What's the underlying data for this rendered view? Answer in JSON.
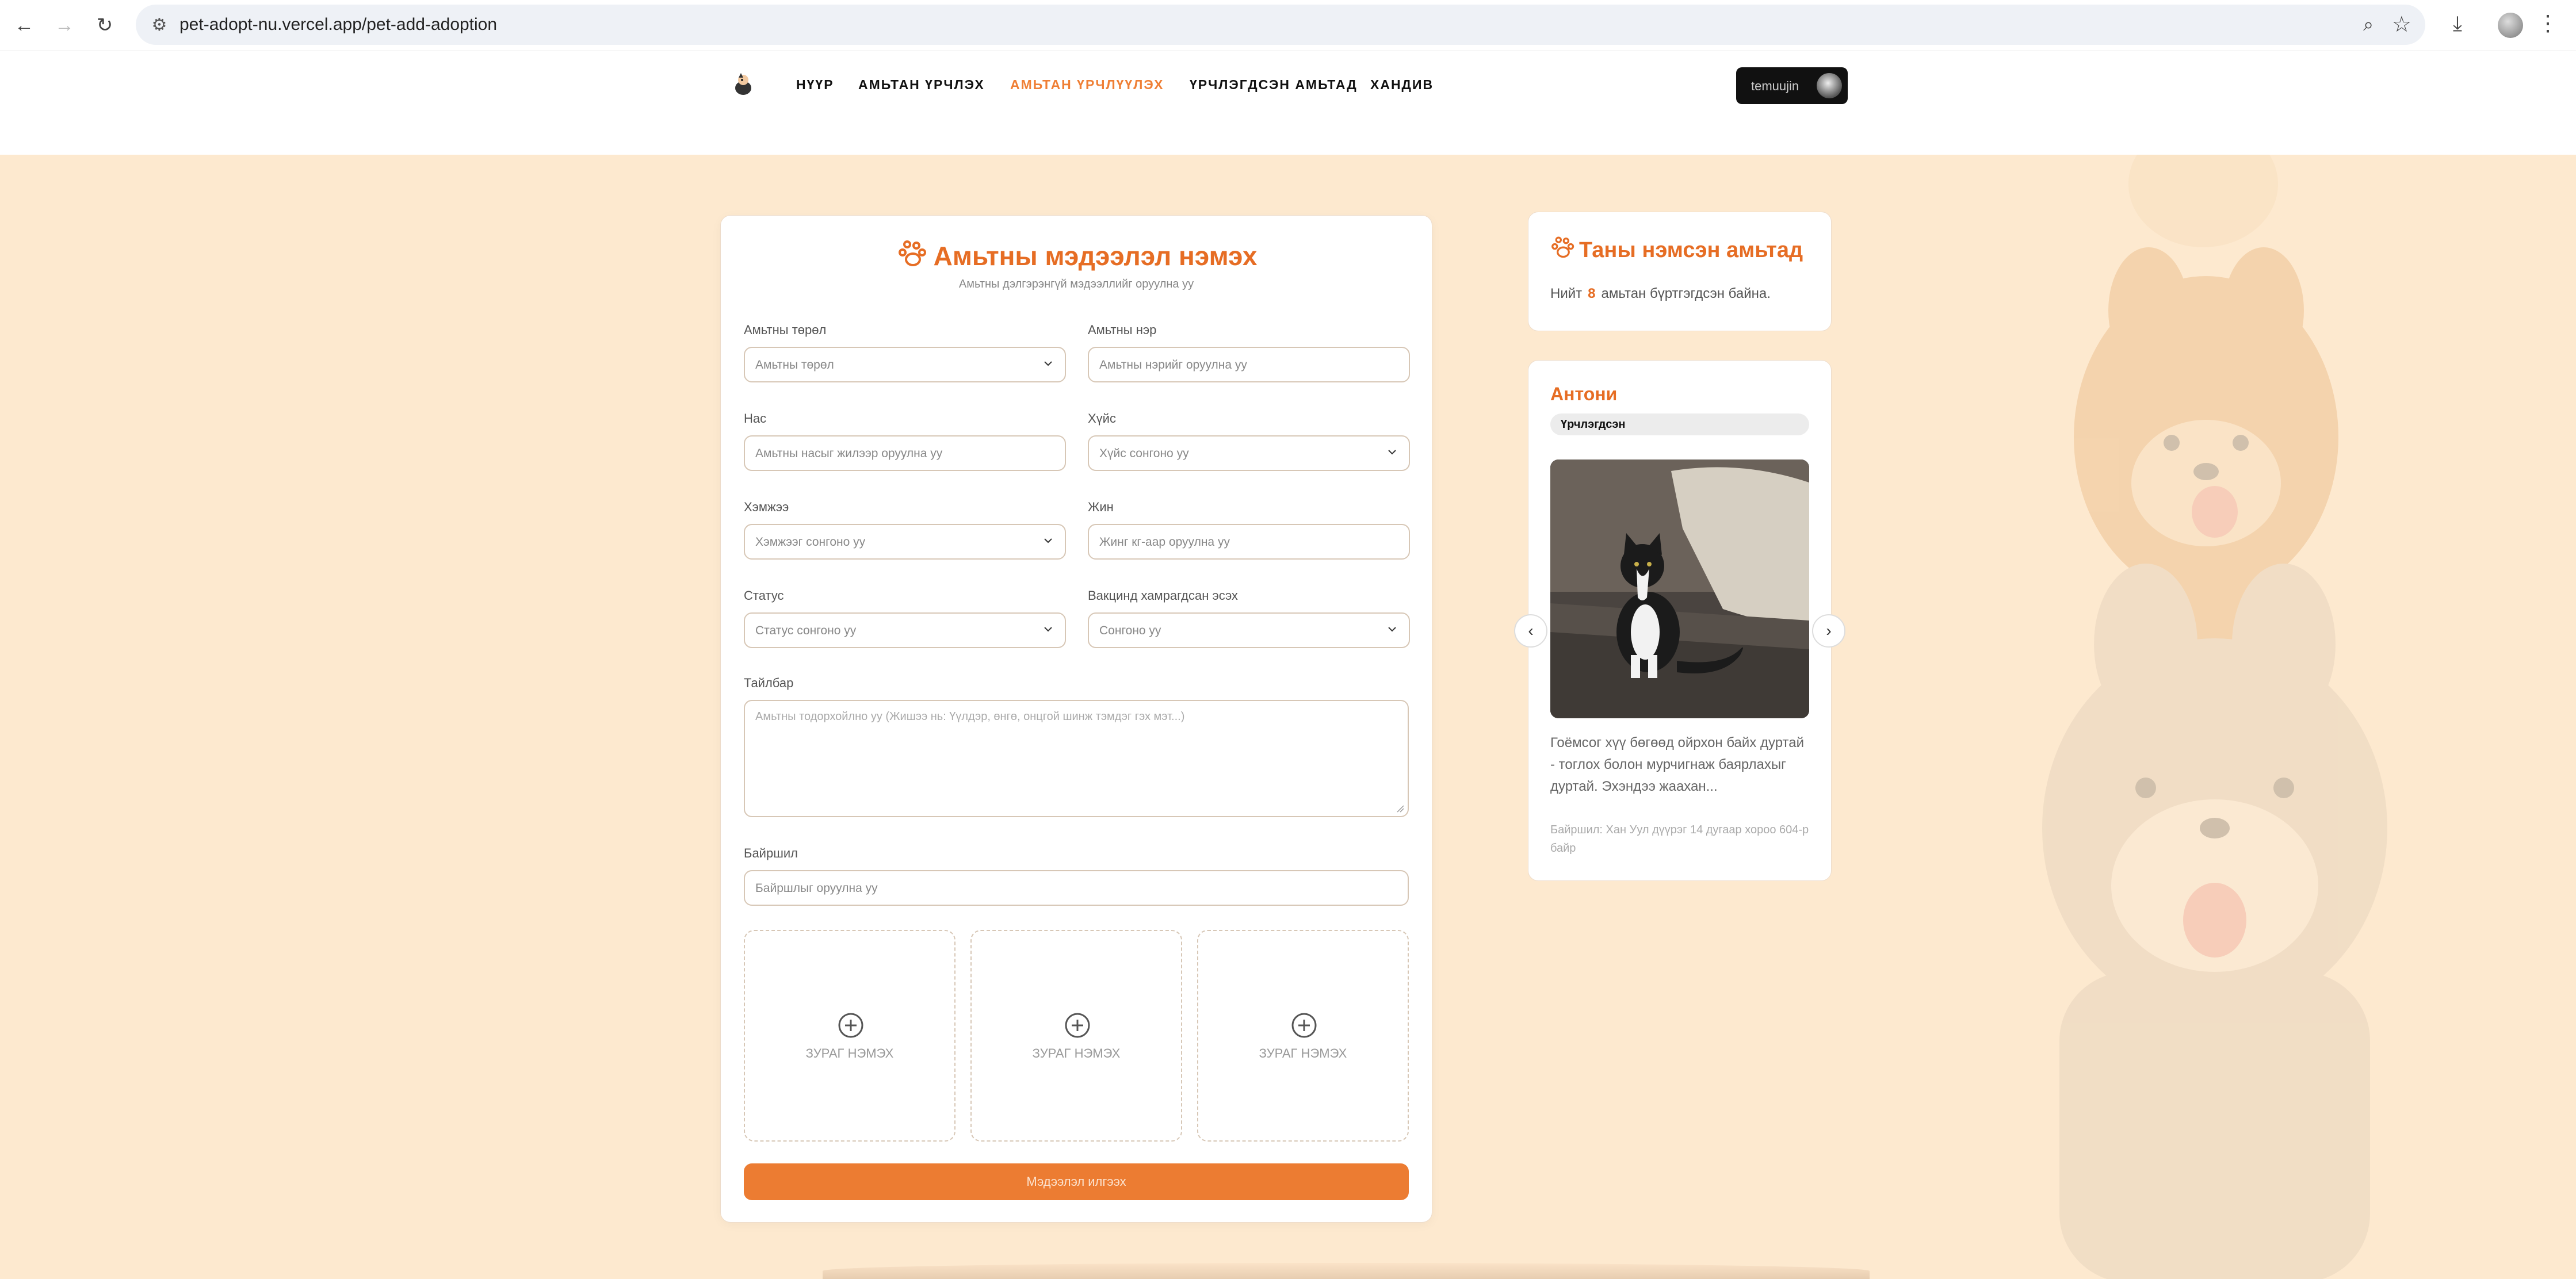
{
  "browser": {
    "url": "pet-adopt-nu.vercel.app/pet-add-adoption"
  },
  "header": {
    "nav": [
      {
        "label": "НҮҮР",
        "active": false
      },
      {
        "label": "АМЬТАН ҮРЧЛЭХ",
        "active": false
      },
      {
        "label": "АМЬТАН ҮРЧЛҮҮЛЭХ",
        "active": true
      },
      {
        "label": "ҮРЧЛЭГДСЭН АМЬТАД",
        "active": false
      },
      {
        "label": "ХАНДИВ",
        "active": false
      }
    ],
    "user": "temuujin"
  },
  "form": {
    "title": "Амьтны мэдээлэл нэмэх",
    "subtitle": "Амьтны дэлгэрэнгүй мэдээллийг оруулна уу",
    "fields": {
      "type": {
        "label": "Амьтны төрөл",
        "placeholder": "Амьтны төрөл"
      },
      "name": {
        "label": "Амьтны нэр",
        "placeholder": "Амьтны нэрийг оруулна уу"
      },
      "age": {
        "label": "Нас",
        "placeholder": "Амьтны насыг жилээр оруулна уу"
      },
      "gender": {
        "label": "Хүйс",
        "placeholder": "Хүйс сонгоно уу"
      },
      "size": {
        "label": "Хэмжээ",
        "placeholder": "Хэмжээг сонгоно уу"
      },
      "weight": {
        "label": "Жин",
        "placeholder": "Жинг кг-аар оруулна уу"
      },
      "status": {
        "label": "Статус",
        "placeholder": "Статус сонгоно уу"
      },
      "vaccine": {
        "label": "Вакцинд хамрагдсан эсэх",
        "placeholder": "Сонгоно уу"
      },
      "description": {
        "label": "Тайлбар",
        "placeholder": "Амьтны тодорхойлно уу (Жишээ нь: Үүлдэр, өнгө, онцгой шинж тэмдэг гэх мэт...)"
      },
      "location": {
        "label": "Байршил",
        "placeholder": "Байршлыг оруулна уу"
      }
    },
    "upload_label": "ЗУРАГ НЭМЭХ",
    "submit_label": "Мэдээлэл илгээх"
  },
  "sidebar": {
    "title": "Таны нэмсэн амьтад",
    "count_prefix": "Нийт",
    "count": "8",
    "count_suffix": "амьтан бүртгэгдсэн байна.",
    "pet": {
      "name": "Антони",
      "status": "Үрчлэгдсэн",
      "description": "Гоёмсог хүү бөгөөд ойрхон байх дуртай - тоглох болон мурчигнаж баярлахыг дуртай. Эхэндээ жаахан...",
      "location": "Байршил: Хан Уул дүүрэг 14 дугаар хороо 604-р байр"
    }
  },
  "colors": {
    "accent": "#ec7c32",
    "background": "#fde9cf"
  }
}
